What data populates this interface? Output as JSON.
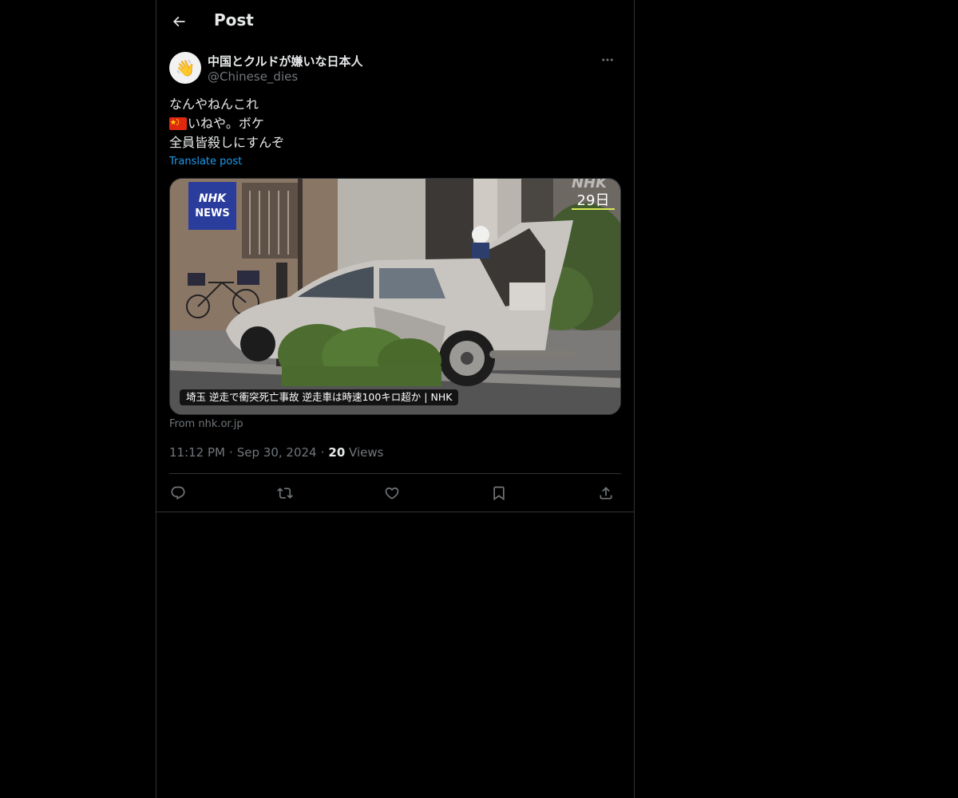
{
  "header": {
    "title": "Post"
  },
  "author": {
    "display_name": "中国とクルドが嫌いな日本人",
    "handle": "@Chinese_dies",
    "avatar_emoji": "👋"
  },
  "post": {
    "lines": [
      "なんやねんこれ",
      "いねや。ボケ",
      "全員皆殺しにすんぞ"
    ],
    "flag_icon": "china-flag-icon",
    "translate_label": "Translate post"
  },
  "card": {
    "caption": "埼玉 逆走で衝突死亡事故 逆走車は時速100キロ超か | NHK",
    "source": "From nhk.or.jp",
    "logo_line1": "NHK",
    "logo_line2": "NEWS",
    "date_badge": "29日",
    "watermark": "NHK"
  },
  "meta": {
    "time": "11:12 PM",
    "date": "Sep 30, 2024",
    "views_count": "20",
    "views_label": "Views",
    "separator": "·"
  },
  "actions": [
    "reply-icon",
    "repost-icon",
    "like-icon",
    "bookmark-icon",
    "share-icon"
  ],
  "colors": {
    "background": "#000000",
    "text": "#e7e9ea",
    "muted": "#71767b",
    "accent": "#1d9bf0",
    "border": "#2f3336",
    "nhk_blue": "#2a3c9c"
  }
}
